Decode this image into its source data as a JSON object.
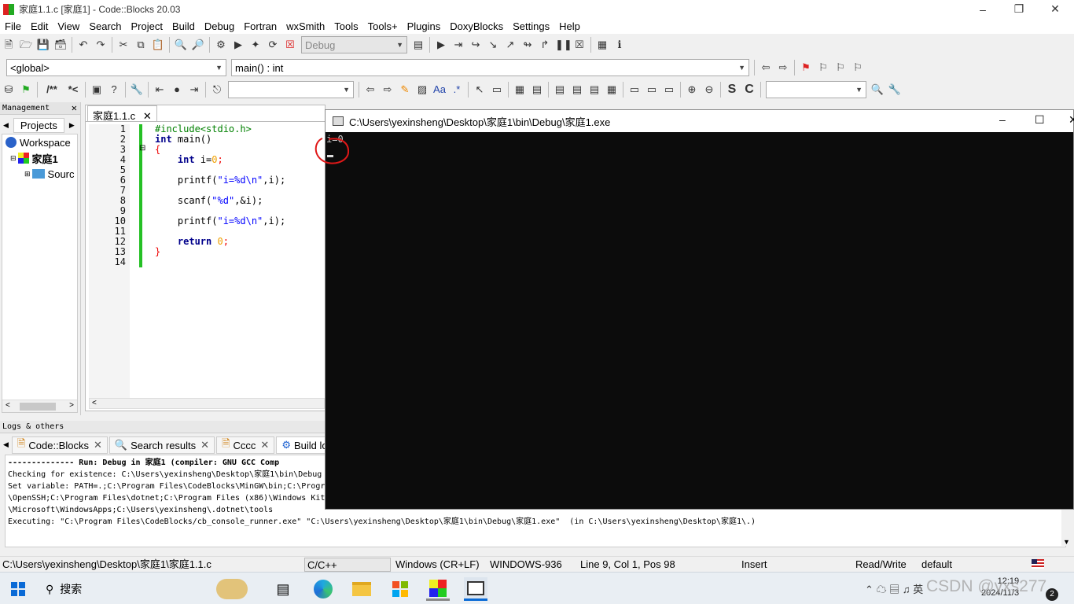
{
  "window": {
    "title": "家庭1.1.c [家庭1] - Code::Blocks 20.03"
  },
  "menu": [
    "File",
    "Edit",
    "View",
    "Search",
    "Project",
    "Build",
    "Debug",
    "Fortran",
    "wxSmith",
    "Tools",
    "Tools+",
    "Plugins",
    "DoxyBlocks",
    "Settings",
    "Help"
  ],
  "toolbar": {
    "build_target": "Debug",
    "scope": "<global>",
    "function": "main() : int"
  },
  "management": {
    "title": "Management",
    "tab_projects": "Projects",
    "workspace": "Workspace",
    "project": "家庭1",
    "sources": "Sourc"
  },
  "editor": {
    "tab_label": "家庭1.1.c",
    "line_numbers": [
      "1",
      "2",
      "3",
      "4",
      "5",
      "6",
      "7",
      "8",
      "9",
      "10",
      "11",
      "12",
      "13",
      "14"
    ],
    "code": {
      "l1": "#include<stdio.h>",
      "l2_kw": "int",
      "l2_rest": " main()",
      "l3": "{",
      "l4_kw": "int",
      "l4_var": " i=",
      "l4_num": "0",
      "l4_end": ";",
      "l6_fn": "printf(",
      "l6_str": "\"i=%d\\n\"",
      "l6_rest": ",i);",
      "l8_fn": "scanf(",
      "l8_str": "\"%d\"",
      "l8_rest": ",&i);",
      "l10_fn": "printf(",
      "l10_str": "\"i=%d\\n\"",
      "l10_rest": ",i);",
      "l12_kw": "return",
      "l12_num": " 0",
      "l12_end": ";",
      "l13": "}"
    }
  },
  "console": {
    "title": "C:\\Users\\yexinsheng\\Desktop\\家庭1\\bin\\Debug\\家庭1.exe",
    "output": "i=0"
  },
  "logs": {
    "title": "Logs & others",
    "tabs": [
      "Code::Blocks",
      "Search results",
      "Cccc",
      "Build lo"
    ],
    "lines": [
      "-------------- Run: Debug in 家庭1 (compiler: GNU GCC Comp",
      "Checking for existence: C:\\Users\\yexinsheng\\Desktop\\家庭1\\bin\\Debug",
      "Set variable: PATH=.;C:\\Program Files\\CodeBlocks\\MinGW\\bin;C:\\Progra",
      "\\OpenSSH;C:\\Program Files\\dotnet;C:\\Program Files (x86)\\Windows Kit",
      "\\Microsoft\\WindowsApps;C:\\Users\\yexinsheng\\.dotnet\\tools",
      "Executing: \"C:\\Program Files\\CodeBlocks/cb_console_runner.exe\" \"C:\\Users\\yexinsheng\\Desktop\\家庭1\\bin\\Debug\\家庭1.exe\"  (in C:\\Users\\yexinsheng\\Desktop\\家庭1\\.)"
    ]
  },
  "status": {
    "path": "C:\\Users\\yexinsheng\\Desktop\\家庭1\\家庭1.1.c",
    "lang": "C/C++",
    "eol": "Windows (CR+LF)",
    "encoding": "WINDOWS-936",
    "position": "Line 9, Col 1, Pos 98",
    "mode": "Insert",
    "access": "Read/Write",
    "profile": "default"
  },
  "taskbar": {
    "search": "搜索",
    "time": "12:19",
    "date": "2024/11/3",
    "watermark": "CSDN @yxs277",
    "ime": "英"
  }
}
